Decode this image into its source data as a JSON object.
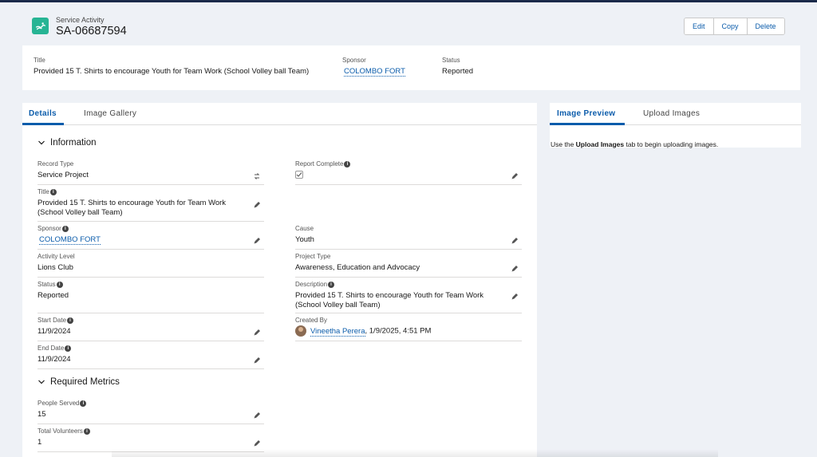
{
  "header": {
    "object_type": "Service Activity",
    "record_name": "SA-06687594",
    "buttons": {
      "edit": "Edit",
      "copy": "Copy",
      "delete": "Delete"
    }
  },
  "highlights": {
    "title_label": "Title",
    "title_value": "Provided 15 T. Shirts to encourage Youth for Team Work (School Volley ball Team)",
    "sponsor_label": "Sponsor",
    "sponsor_value": "COLOMBO FORT",
    "status_label": "Status",
    "status_value": "Reported"
  },
  "main_tabs": {
    "details": "Details",
    "gallery": "Image Gallery"
  },
  "sections": {
    "information": "Information",
    "metrics": "Required Metrics"
  },
  "fields": {
    "record_type": {
      "label": "Record Type",
      "value": "Service Project"
    },
    "report_complete": {
      "label": "Report Complete"
    },
    "title": {
      "label": "Title",
      "value": "Provided 15 T. Shirts to encourage Youth for Team Work (School Volley ball Team)"
    },
    "sponsor": {
      "label": "Sponsor",
      "value": "COLOMBO FORT"
    },
    "cause": {
      "label": "Cause",
      "value": "Youth"
    },
    "activity_level": {
      "label": "Activity Level",
      "value": "Lions Club"
    },
    "project_type": {
      "label": "Project Type",
      "value": "Awareness, Education and Advocacy"
    },
    "status": {
      "label": "Status",
      "value": "Reported"
    },
    "description": {
      "label": "Description",
      "value": "Provided 15 T. Shirts to encourage Youth for Team Work (School Volley ball Team)"
    },
    "start_date": {
      "label": "Start Date",
      "value": "11/9/2024"
    },
    "created_by": {
      "label": "Created By",
      "user": "Vineetha Perera",
      "date": ", 1/9/2025, 4:51 PM"
    },
    "end_date": {
      "label": "End Date",
      "value": "11/9/2024"
    },
    "people_served": {
      "label": "People Served",
      "value": "15"
    },
    "total_volunteers": {
      "label": "Total Volunteers",
      "value": "1"
    }
  },
  "side": {
    "tabs": {
      "preview": "Image Preview",
      "upload": "Upload Images"
    },
    "note_pre": "Use the ",
    "note_bold": "Upload Images",
    "note_post": " tab to begin uploading images."
  },
  "colors": {
    "accent": "#0b5cab",
    "object_icon": "#27b494"
  },
  "info_glyph": "i"
}
